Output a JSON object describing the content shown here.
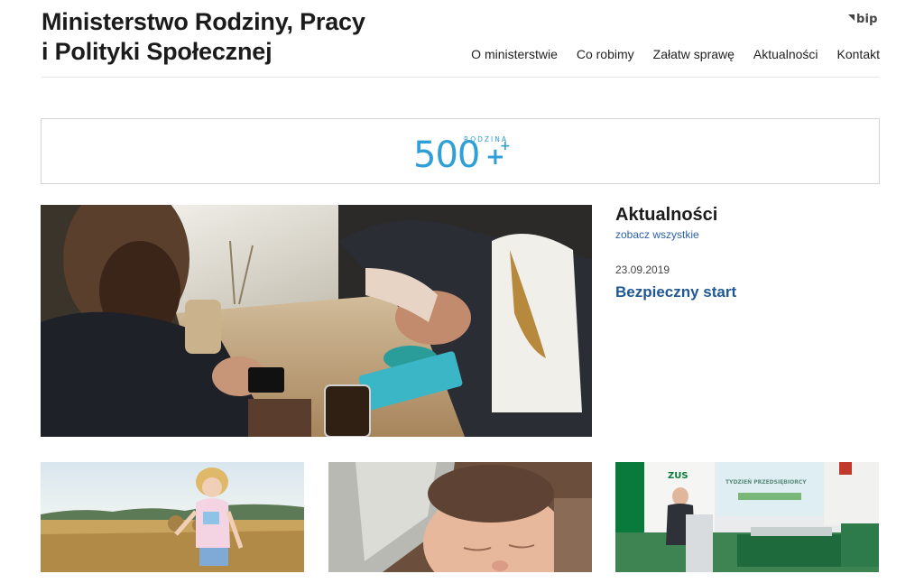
{
  "header": {
    "title_line1": "Ministerstwo Rodziny, Pracy",
    "title_line2": "i Polityki Społecznej",
    "bip_label": "bip",
    "nav": [
      {
        "label": "O ministerstwie"
      },
      {
        "label": "Co robimy"
      },
      {
        "label": "Załatw sprawę"
      },
      {
        "label": "Aktualności"
      },
      {
        "label": "Kontakt"
      }
    ]
  },
  "banner": {
    "logo_number": "500",
    "logo_caption": "RODZINA",
    "logo_plus": "+"
  },
  "news": {
    "heading": "Aktualności",
    "see_all": "zobacz wszystkie",
    "items": [
      {
        "date": "23.09.2019",
        "title": "Bezpieczny start"
      }
    ]
  },
  "thumbnails": {
    "zus_logo": "ZUS",
    "zus_screen_title": "TYDZIEŃ PRZEDSIĘBIORCY"
  },
  "colors": {
    "brand_blue": "#2f9fd8",
    "link_blue": "#2b62a8",
    "title_blue": "#1f5896",
    "zus_green": "#0a7a3c"
  }
}
